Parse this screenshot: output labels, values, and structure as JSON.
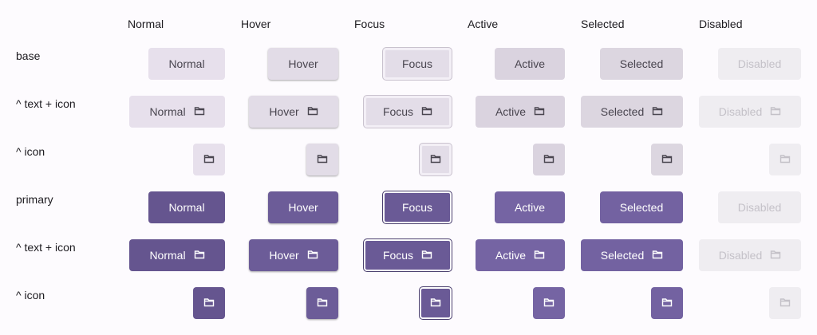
{
  "columns": [
    "Normal",
    "Hover",
    "Focus",
    "Active",
    "Selected",
    "Disabled"
  ],
  "rows": [
    {
      "label": "base"
    },
    {
      "label": "^ text + icon"
    },
    {
      "label": "^ icon"
    },
    {
      "label": "primary"
    },
    {
      "label": "^ text + icon"
    },
    {
      "label": "^ icon"
    }
  ],
  "buttons": {
    "normal": "Normal",
    "hover": "Hover",
    "focus": "Focus",
    "active": "Active",
    "selected": "Selected",
    "disabled": "Disabled"
  },
  "icon": "folder-icon",
  "colors": {
    "base_bg": "#e7e0ec",
    "primary_bg": "#65558f",
    "disabled_bg": "#efedf1",
    "page_bg": "#fdfbfe"
  }
}
